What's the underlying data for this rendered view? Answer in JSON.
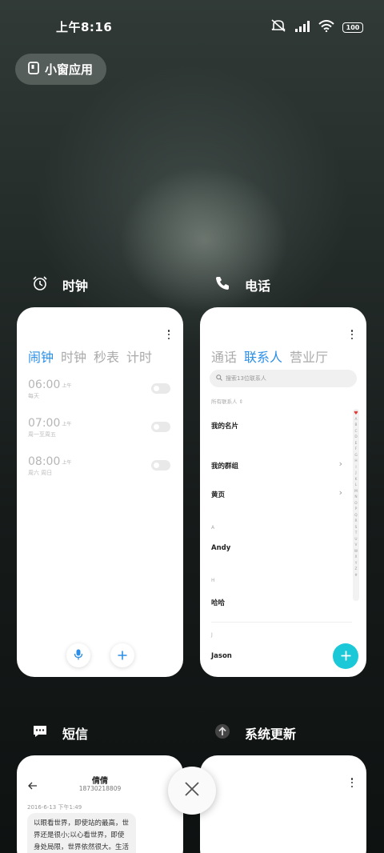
{
  "status_bar": {
    "time": "上午8:16",
    "battery": "100"
  },
  "small_window": {
    "label": "小窗应用"
  },
  "apps": {
    "clock": {
      "name": "时钟",
      "tabs": [
        "闹钟",
        "时钟",
        "秒表",
        "计时"
      ],
      "alarms": [
        {
          "time": "06:00",
          "period": "上午",
          "repeat": "每天"
        },
        {
          "time": "07:00",
          "period": "上午",
          "repeat": "周一至周五"
        },
        {
          "time": "08:00",
          "period": "上午",
          "repeat": "周六 周日"
        }
      ]
    },
    "phone": {
      "name": "电话",
      "tabs": [
        "通话",
        "联系人",
        "营业厅"
      ],
      "search_placeholder": "搜索13位联系人",
      "all_contacts": "所有联系人",
      "my_card": "我的名片",
      "my_groups": "我的群组",
      "yellow_pages": "黄页",
      "sections": [
        {
          "letter": "A",
          "name": "Andy"
        },
        {
          "letter": "H",
          "name": "哈哈"
        },
        {
          "letter": "J",
          "name": "Jason"
        }
      ],
      "index_letters": [
        "♥",
        "A",
        "B",
        "C",
        "D",
        "E",
        "F",
        "G",
        "H",
        "I",
        "J",
        "K",
        "L",
        "M",
        "N",
        "O",
        "P",
        "Q",
        "R",
        "S",
        "T",
        "U",
        "V",
        "W",
        "X",
        "Y",
        "Z",
        "#"
      ]
    },
    "messages": {
      "name": "短信",
      "contact_name": "倩倩",
      "contact_number": "18730218809",
      "timestamp": "2016-6-13 下午1:49",
      "message": "以眼看世界，即使站的最高，世界还是很小;以心看世界，即使身处局限，世界依然很大。生活远"
    },
    "system_update": {
      "name": "系统更新"
    }
  }
}
